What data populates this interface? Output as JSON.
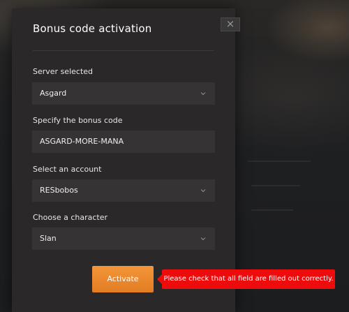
{
  "dialog": {
    "title": "Bonus code activation",
    "close_label": "×"
  },
  "form": {
    "server": {
      "label": "Server selected",
      "value": "Asgard"
    },
    "bonus_code": {
      "label": "Specify the bonus code",
      "value": "ASGARD-MORE-MANA"
    },
    "account": {
      "label": "Select an account",
      "value": "RESbobos"
    },
    "character": {
      "label": "Choose a character",
      "value": "Slan"
    }
  },
  "activate_label": "Activate",
  "error_message": "Please check that all field are filled out correctly.",
  "colors": {
    "accent": "#f08a2e",
    "error": "#ee0b0b",
    "modal_bg": "#2a2828",
    "field_bg": "#353333"
  }
}
